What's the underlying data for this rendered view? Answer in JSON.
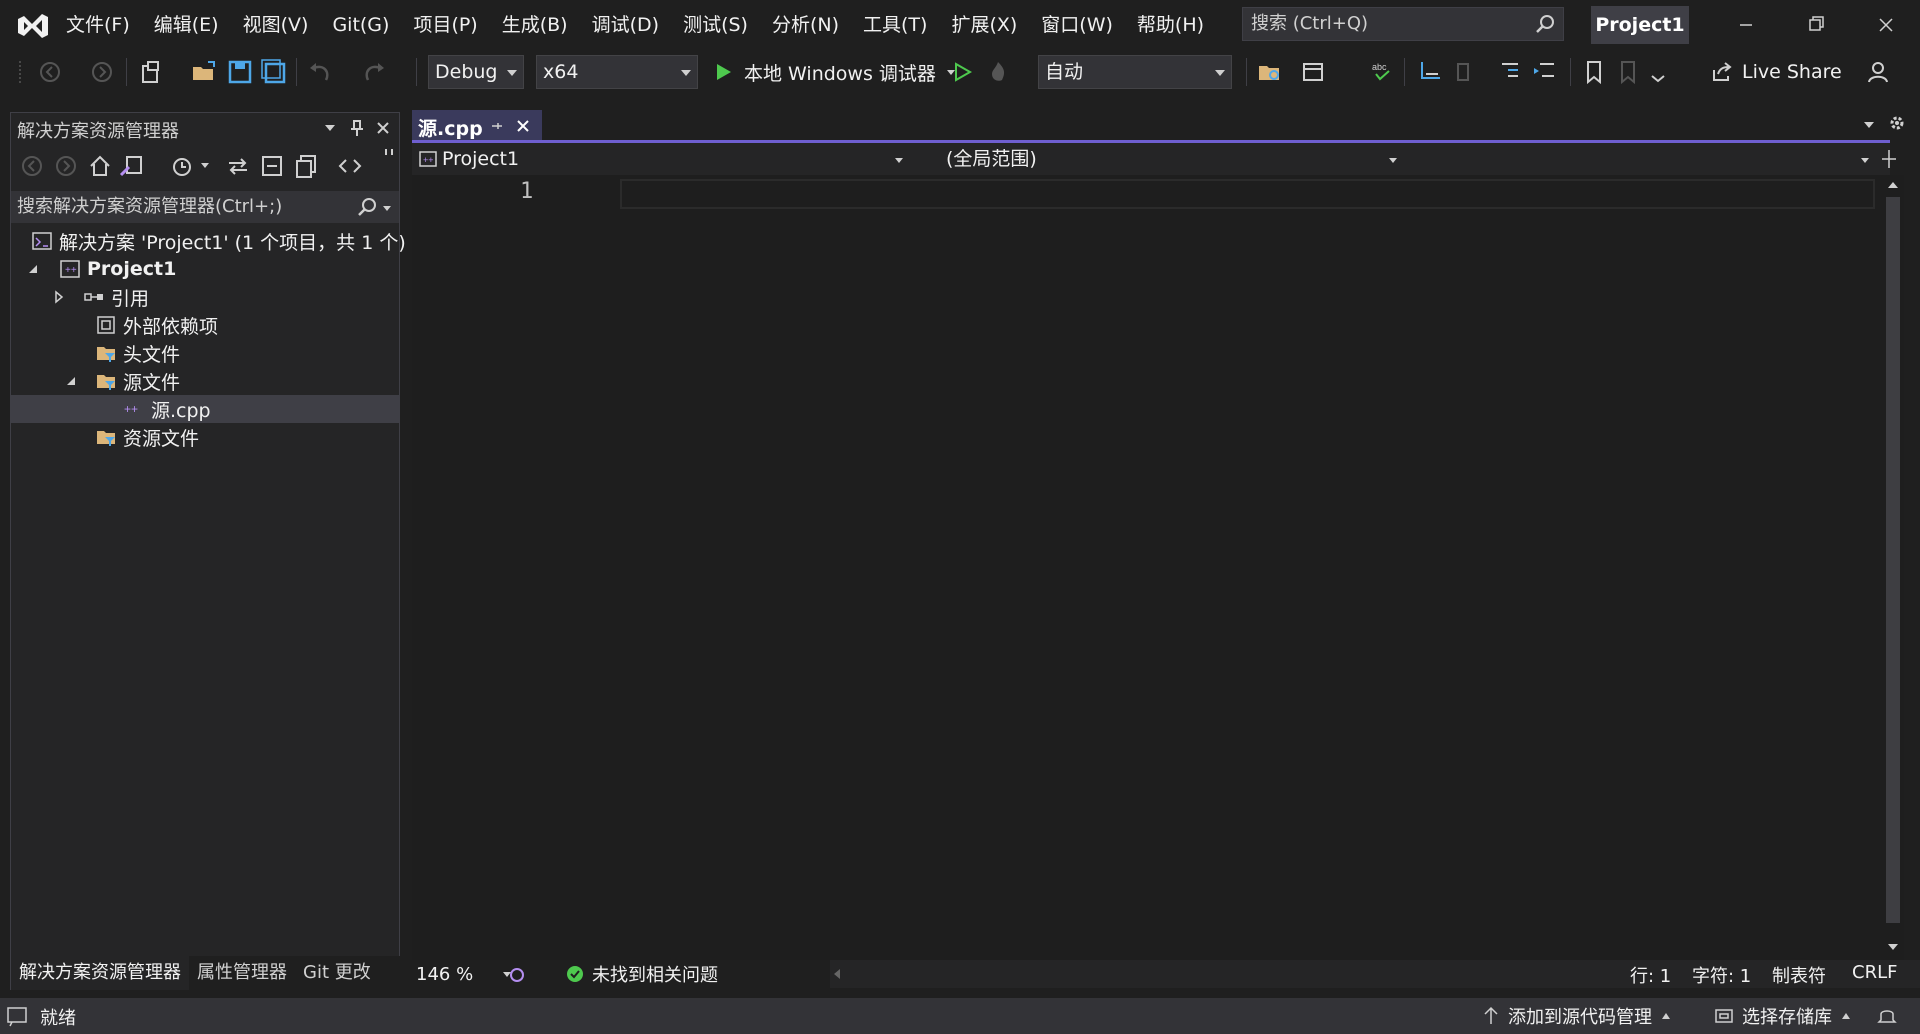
{
  "menu": [
    "文件(F)",
    "编辑(E)",
    "视图(V)",
    "Git(G)",
    "项目(P)",
    "生成(B)",
    "调试(D)",
    "测试(S)",
    "分析(N)",
    "工具(T)",
    "扩展(X)",
    "窗口(W)",
    "帮助(H)"
  ],
  "search": {
    "placeholder": "搜索 (Ctrl+Q)"
  },
  "window": {
    "project_title": "Project1"
  },
  "toolbar": {
    "config": "Debug",
    "platform": "x64",
    "run_label": "本地 Windows 调试器",
    "auto": "自动",
    "live_share": "Live Share"
  },
  "solution_explorer": {
    "title": "解决方案资源管理器",
    "search_placeholder": "搜索解决方案资源管理器(Ctrl+;)",
    "tree": {
      "solution": "解决方案 'Project1' (1 个项目，共 1 个)",
      "project": "Project1",
      "references": "引用",
      "external_deps": "外部依赖项",
      "headers": "头文件",
      "sources": "源文件",
      "source_file": "源.cpp",
      "resources": "资源文件"
    },
    "tabs": [
      "解决方案资源管理器",
      "属性管理器",
      "Git 更改"
    ]
  },
  "editor": {
    "tab_label": "源.cpp",
    "nav_project": "Project1",
    "nav_scope": "(全局范围)",
    "line_number": "1",
    "zoom": "146 %",
    "issues": "未找到相关问题",
    "line": "行: 1",
    "char": "字符: 1",
    "tabs_mode": "制表符",
    "eol": "CRLF"
  },
  "status": {
    "ready": "就绪",
    "add_source_control": "添加到源代码管理",
    "select_repo": "选择存储库"
  },
  "colors": {
    "accent": "#6f5fd0",
    "play_green": "#4ec94e",
    "folder_yellow": "#dcb67a"
  }
}
